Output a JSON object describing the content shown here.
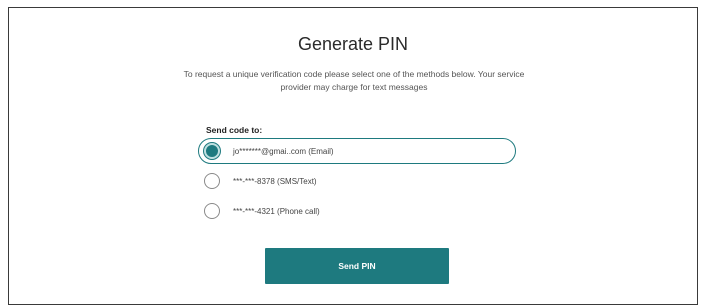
{
  "page": {
    "title": "Generate PIN",
    "description": "To request a unique verification code please select one of the methods below. Your service provider may charge for text messages",
    "send_to_label": "Send code to:"
  },
  "methods": [
    {
      "label": "jo*******@gmai..com (Email)",
      "selected": true
    },
    {
      "label": "***-***-8378 (SMS/Text)",
      "selected": false
    },
    {
      "label": "***-***-4321 (Phone call)",
      "selected": false
    }
  ],
  "actions": {
    "send_label": "Send PIN"
  },
  "colors": {
    "accent": "#1e7a7f",
    "border": "#3a3a3a"
  }
}
